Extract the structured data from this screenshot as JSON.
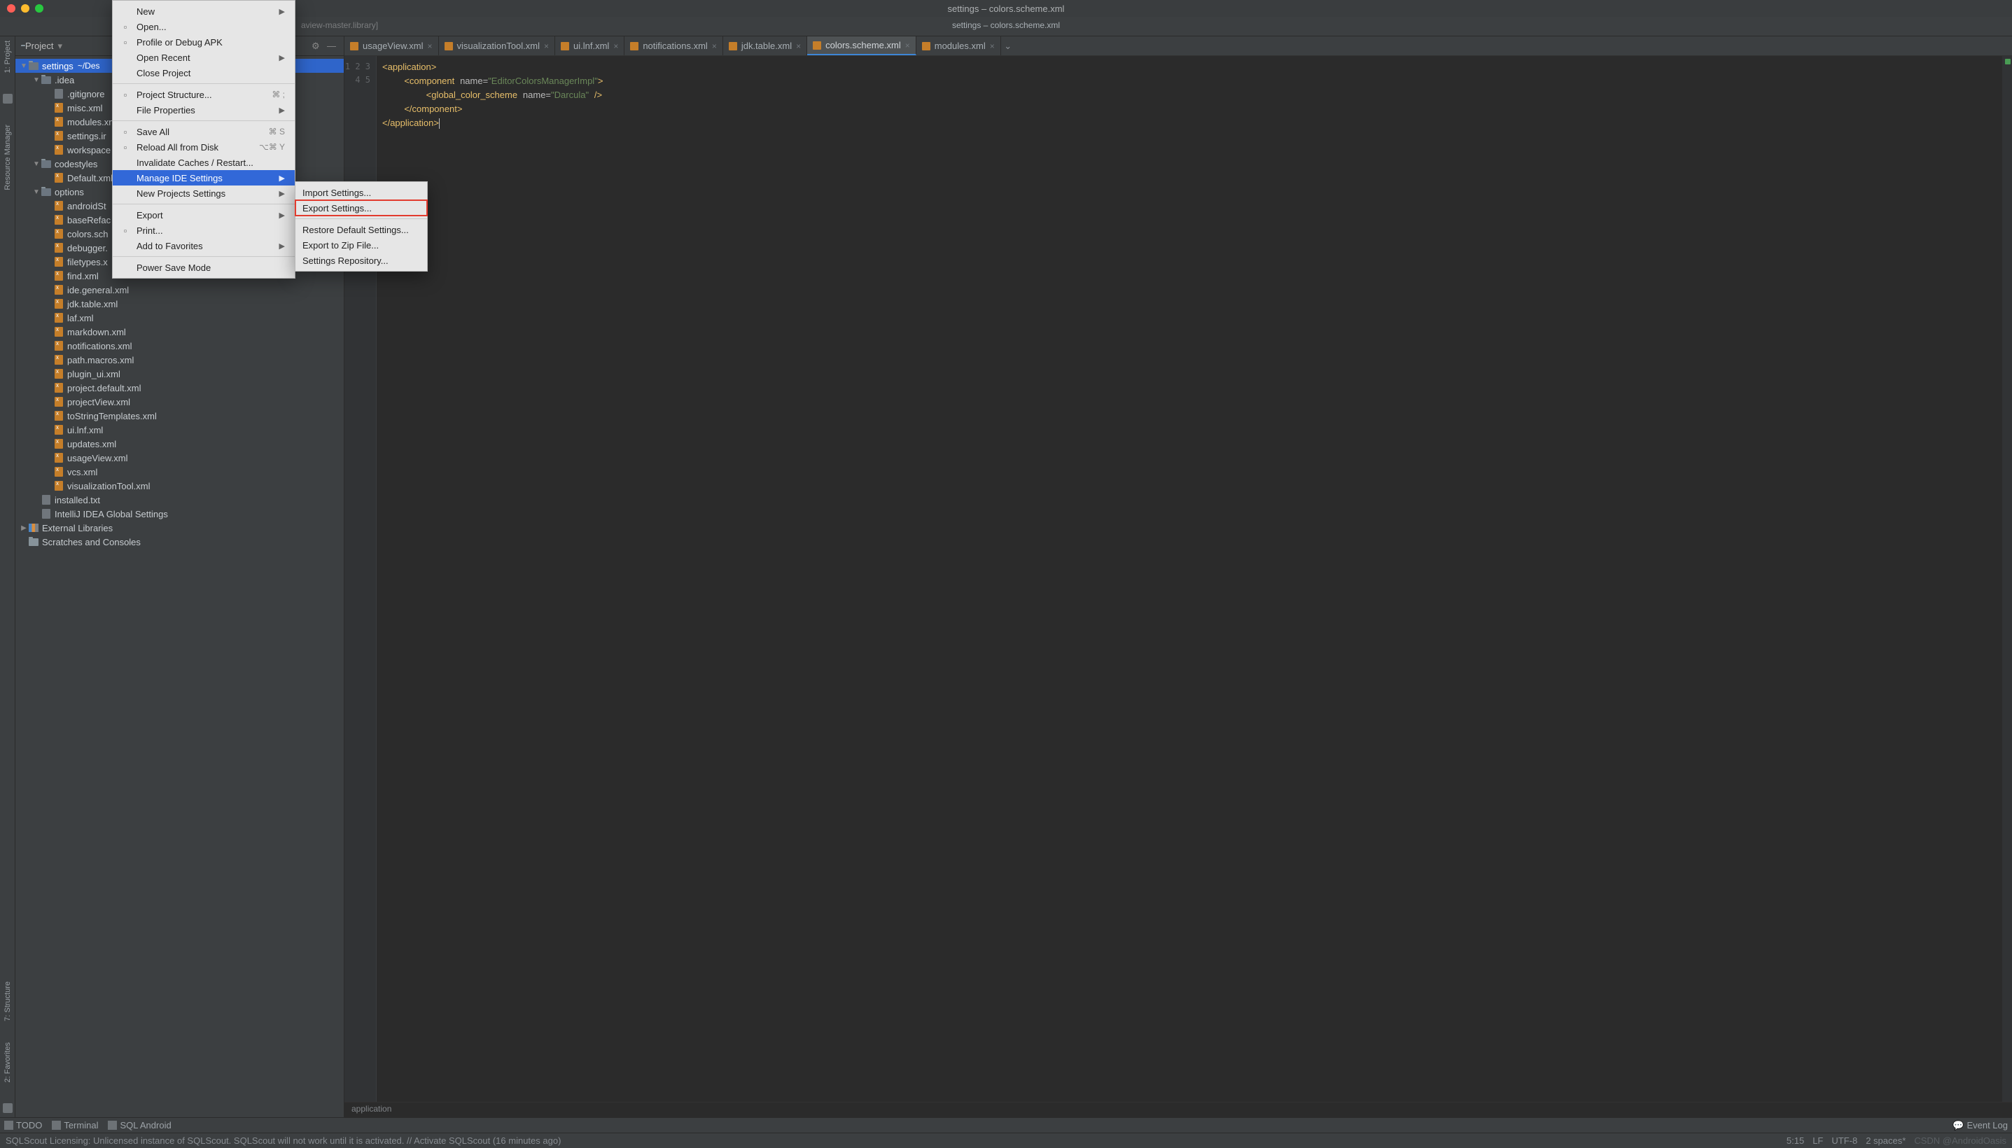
{
  "window": {
    "title": "settings – colors.scheme.xml"
  },
  "navbar": {
    "path_suffix": "aview-master.library]",
    "tab_label": "settings – colors.scheme.xml"
  },
  "left_tools": [
    {
      "label": "1: Project"
    },
    {
      "label": "Resource Manager"
    },
    {
      "label": "7: Structure"
    },
    {
      "label": "2: Favorites"
    }
  ],
  "project": {
    "header_label": "Project",
    "root_name": "settings",
    "root_path": "~/Des",
    "nodes": [
      {
        "depth": 0,
        "arrow": "▼",
        "icon": "folder-open",
        "name": "settings",
        "path": "~/Des",
        "sel": true
      },
      {
        "depth": 1,
        "arrow": "▼",
        "icon": "folder-open",
        "name": ".idea"
      },
      {
        "depth": 2,
        "arrow": "",
        "icon": "file-txt",
        "name": ".gitignore"
      },
      {
        "depth": 2,
        "arrow": "",
        "icon": "file-xml",
        "name": "misc.xml"
      },
      {
        "depth": 2,
        "arrow": "",
        "icon": "file-xml",
        "name": "modules.xml"
      },
      {
        "depth": 2,
        "arrow": "",
        "icon": "file-xml",
        "name": "settings.ir"
      },
      {
        "depth": 2,
        "arrow": "",
        "icon": "file-xml",
        "name": "workspace"
      },
      {
        "depth": 1,
        "arrow": "▼",
        "icon": "folder-open",
        "name": "codestyles"
      },
      {
        "depth": 2,
        "arrow": "",
        "icon": "file-xml",
        "name": "Default.xml"
      },
      {
        "depth": 1,
        "arrow": "▼",
        "icon": "folder-open",
        "name": "options"
      },
      {
        "depth": 2,
        "arrow": "",
        "icon": "file-xml",
        "name": "androidSt"
      },
      {
        "depth": 2,
        "arrow": "",
        "icon": "file-xml",
        "name": "baseRefac"
      },
      {
        "depth": 2,
        "arrow": "",
        "icon": "file-xml",
        "name": "colors.sch"
      },
      {
        "depth": 2,
        "arrow": "",
        "icon": "file-xml",
        "name": "debugger."
      },
      {
        "depth": 2,
        "arrow": "",
        "icon": "file-xml",
        "name": "filetypes.x"
      },
      {
        "depth": 2,
        "arrow": "",
        "icon": "file-xml",
        "name": "find.xml"
      },
      {
        "depth": 2,
        "arrow": "",
        "icon": "file-xml",
        "name": "ide.general.xml"
      },
      {
        "depth": 2,
        "arrow": "",
        "icon": "file-xml",
        "name": "jdk.table.xml"
      },
      {
        "depth": 2,
        "arrow": "",
        "icon": "file-xml",
        "name": "laf.xml"
      },
      {
        "depth": 2,
        "arrow": "",
        "icon": "file-xml",
        "name": "markdown.xml"
      },
      {
        "depth": 2,
        "arrow": "",
        "icon": "file-xml",
        "name": "notifications.xml"
      },
      {
        "depth": 2,
        "arrow": "",
        "icon": "file-xml",
        "name": "path.macros.xml"
      },
      {
        "depth": 2,
        "arrow": "",
        "icon": "file-xml",
        "name": "plugin_ui.xml"
      },
      {
        "depth": 2,
        "arrow": "",
        "icon": "file-xml",
        "name": "project.default.xml"
      },
      {
        "depth": 2,
        "arrow": "",
        "icon": "file-xml",
        "name": "projectView.xml"
      },
      {
        "depth": 2,
        "arrow": "",
        "icon": "file-xml",
        "name": "toStringTemplates.xml"
      },
      {
        "depth": 2,
        "arrow": "",
        "icon": "file-xml",
        "name": "ui.lnf.xml"
      },
      {
        "depth": 2,
        "arrow": "",
        "icon": "file-xml",
        "name": "updates.xml"
      },
      {
        "depth": 2,
        "arrow": "",
        "icon": "file-xml",
        "name": "usageView.xml"
      },
      {
        "depth": 2,
        "arrow": "",
        "icon": "file-xml",
        "name": "vcs.xml"
      },
      {
        "depth": 2,
        "arrow": "",
        "icon": "file-xml",
        "name": "visualizationTool.xml"
      },
      {
        "depth": 1,
        "arrow": "",
        "icon": "file-txt",
        "name": "installed.txt"
      },
      {
        "depth": 1,
        "arrow": "",
        "icon": "file-txt",
        "name": "IntelliJ IDEA Global Settings"
      },
      {
        "depth": 0,
        "arrow": "▶",
        "icon": "lib",
        "name": "External Libraries"
      },
      {
        "depth": 0,
        "arrow": "",
        "icon": "folder",
        "name": "Scratches and Consoles"
      }
    ]
  },
  "tabs": [
    {
      "label": "usageView.xml"
    },
    {
      "label": "visualizationTool.xml"
    },
    {
      "label": "ui.lnf.xml"
    },
    {
      "label": "notifications.xml"
    },
    {
      "label": "jdk.table.xml"
    },
    {
      "label": "colors.scheme.xml",
      "active": true
    },
    {
      "label": "modules.xml"
    }
  ],
  "editor": {
    "lines": [
      "1",
      "2",
      "3",
      "4",
      "5"
    ],
    "code_html": "<span class='tag'>&lt;application&gt;</span>\n    <span class='tag'>&lt;component</span> <span class='attr'>name=</span><span class='val'>\"EditorColorsManagerImpl\"</span><span class='tag'>&gt;</span>\n        <span class='tag'>&lt;global_color_scheme</span> <span class='attr'>name=</span><span class='val'>\"Darcula\"</span> <span class='tag'>/&gt;</span>\n    <span class='tag'>&lt;/component&gt;</span>\n<span class='tag'>&lt;/application&gt;</span><span class='cursor'></span>",
    "breadcrumb": "application"
  },
  "file_menu": [
    {
      "label": "New",
      "sub": true
    },
    {
      "label": "Open...",
      "icon": "open"
    },
    {
      "label": "Profile or Debug APK",
      "icon": "bar"
    },
    {
      "label": "Open Recent",
      "sub": true
    },
    {
      "label": "Close Project"
    },
    {
      "sep": true
    },
    {
      "label": "Project Structure...",
      "icon": "struct",
      "shortcut": "⌘ ;"
    },
    {
      "label": "File Properties",
      "sub": true
    },
    {
      "sep": true
    },
    {
      "label": "Save All",
      "icon": "save",
      "shortcut": "⌘ S"
    },
    {
      "label": "Reload All from Disk",
      "icon": "reload",
      "shortcut": "⌥⌘ Y"
    },
    {
      "label": "Invalidate Caches / Restart..."
    },
    {
      "label": "Manage IDE Settings",
      "hl": true,
      "sub": true
    },
    {
      "label": "New Projects Settings",
      "sub": true
    },
    {
      "sep": true
    },
    {
      "label": "Export",
      "sub": true
    },
    {
      "label": "Print...",
      "icon": "print"
    },
    {
      "label": "Add to Favorites",
      "sub": true
    },
    {
      "sep": true
    },
    {
      "label": "Power Save Mode"
    }
  ],
  "sub_menu": [
    {
      "label": "Import Settings..."
    },
    {
      "label": "Export Settings...",
      "boxed": true
    },
    {
      "sep": true
    },
    {
      "label": "Restore Default Settings..."
    },
    {
      "label": "Export to Zip File..."
    },
    {
      "label": "Settings Repository..."
    }
  ],
  "bottom": {
    "items": [
      {
        "label": "TODO",
        "icon": "todo"
      },
      {
        "label": "Terminal",
        "icon": "term"
      },
      {
        "label": "SQL Android",
        "icon": "sql"
      }
    ],
    "event_log": "Event Log"
  },
  "status": {
    "message": "SQLScout Licensing: Unlicensed instance of SQLScout. SQLScout will not work until it is activated. // Activate SQLScout (16 minutes ago)",
    "caret": "5:15",
    "sep": "LF",
    "enc": "UTF-8",
    "indent": "2 spaces*",
    "wm": "CSDN @AndroidOasis"
  }
}
